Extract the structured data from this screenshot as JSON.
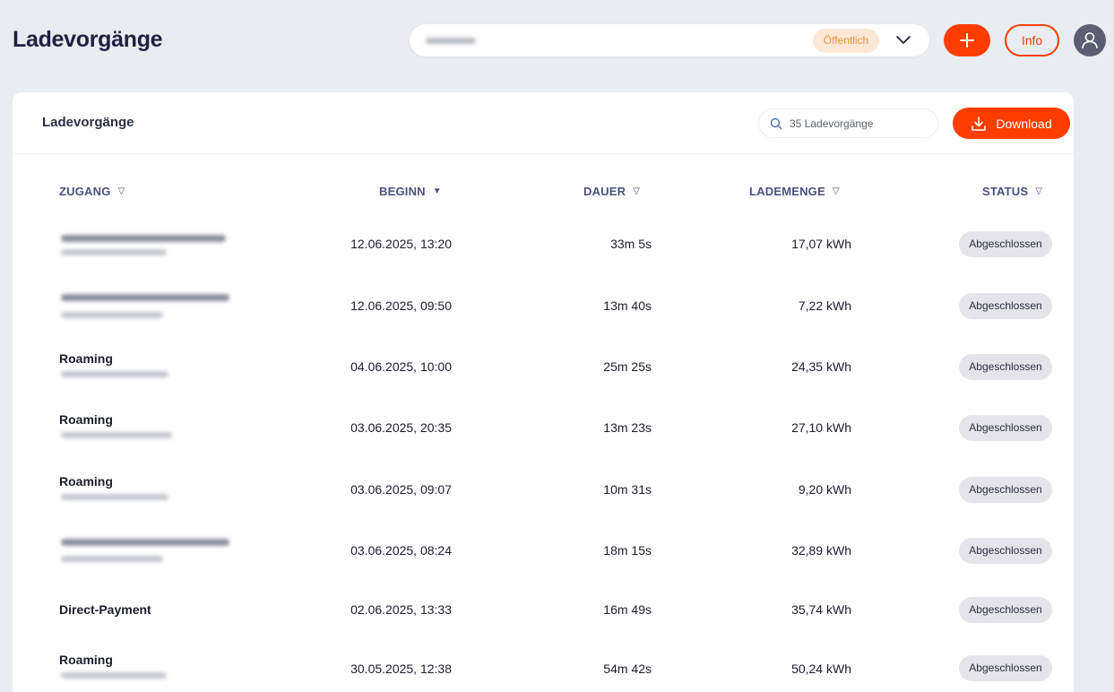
{
  "header": {
    "title": "Ladevorgänge",
    "location_badge": "Öffentlich",
    "info_label": "Info"
  },
  "card": {
    "title": "Ladevorgänge",
    "search_placeholder": "35 Ladevorgänge",
    "download_label": "Download"
  },
  "table": {
    "columns": {
      "access": "ZUGANG",
      "start": "BEGINN",
      "duration": "DAUER",
      "energy": "LADEMENGE",
      "status": "STATUS"
    },
    "rows": [
      {
        "access": "",
        "start": "12.06.2025, 13:20",
        "duration": "33m 5s",
        "energy": "17,07 kWh",
        "status": "Abgeschlossen"
      },
      {
        "access": "",
        "start": "12.06.2025, 09:50",
        "duration": "13m 40s",
        "energy": "7,22 kWh",
        "status": "Abgeschlossen"
      },
      {
        "access": "Roaming",
        "start": "04.06.2025, 10:00",
        "duration": "25m 25s",
        "energy": "24,35 kWh",
        "status": "Abgeschlossen"
      },
      {
        "access": "Roaming",
        "start": "03.06.2025, 20:35",
        "duration": "13m 23s",
        "energy": "27,10 kWh",
        "status": "Abgeschlossen"
      },
      {
        "access": "Roaming",
        "start": "03.06.2025, 09:07",
        "duration": "10m 31s",
        "energy": "9,20 kWh",
        "status": "Abgeschlossen"
      },
      {
        "access": "",
        "start": "03.06.2025, 08:24",
        "duration": "18m 15s",
        "energy": "32,89 kWh",
        "status": "Abgeschlossen"
      },
      {
        "access": "Direct-Payment",
        "start": "02.06.2025, 13:33",
        "duration": "16m 49s",
        "energy": "35,74 kWh",
        "status": "Abgeschlossen"
      },
      {
        "access": "Roaming",
        "start": "30.05.2025, 12:38",
        "duration": "54m 42s",
        "energy": "50,24 kWh",
        "status": "Abgeschlossen"
      }
    ]
  },
  "colors": {
    "accent": "#ff3d00",
    "background": "#e9ecf1",
    "header_text": "#4b5180"
  }
}
